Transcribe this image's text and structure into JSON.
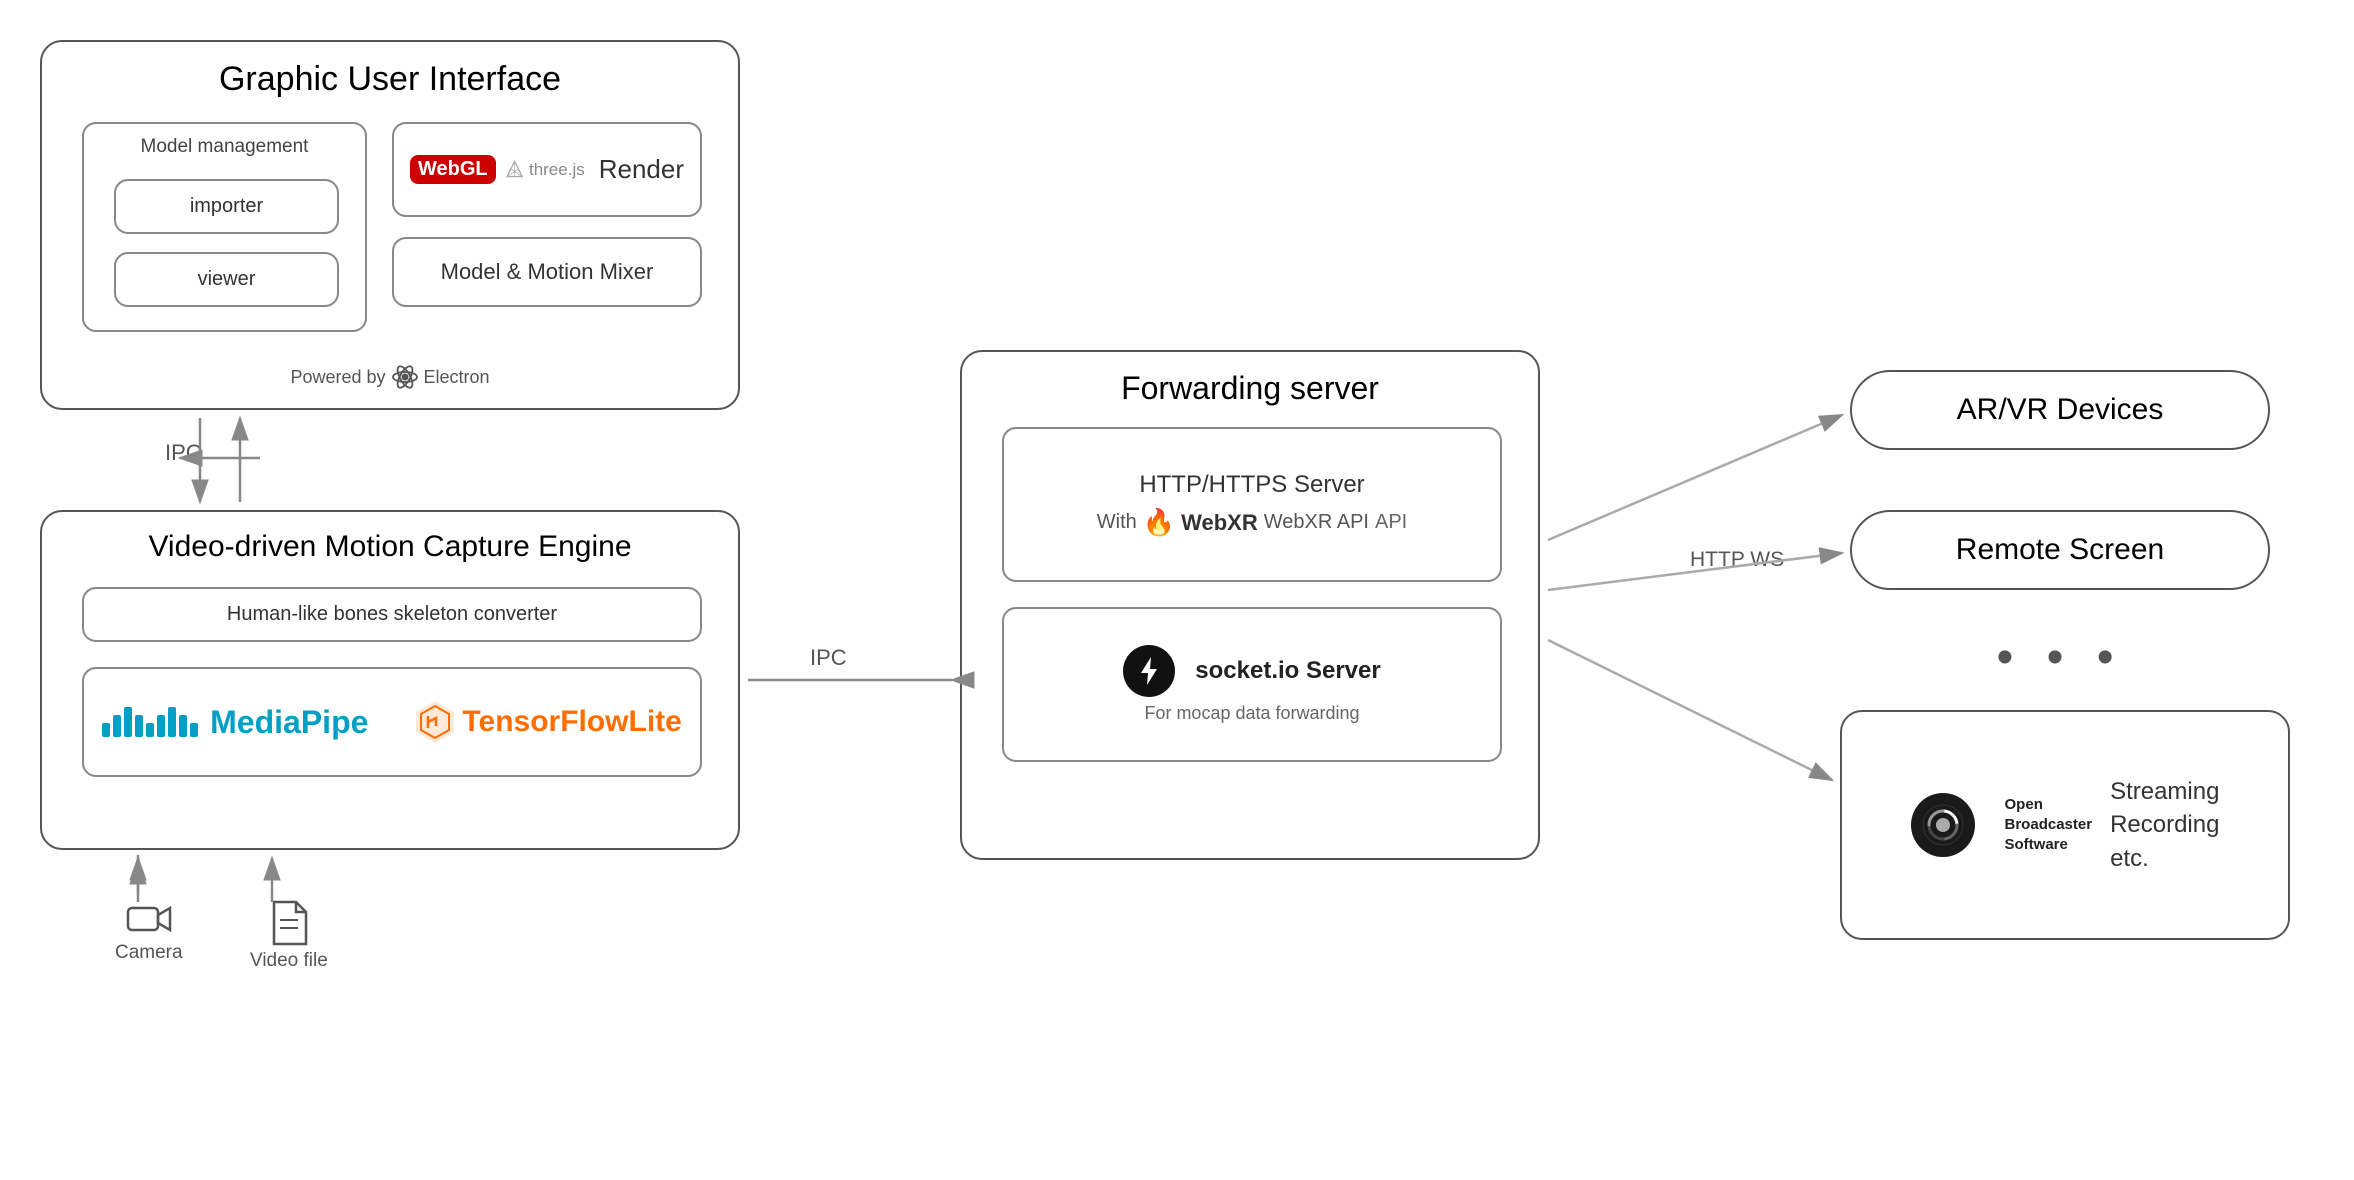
{
  "gui": {
    "title": "Graphic User Interface",
    "model_mgmt_label": "Model management",
    "importer_label": "importer",
    "viewer_label": "viewer",
    "webgl_label": "Render",
    "threejs_text": "three.js",
    "mixer_label": "Model & Motion Mixer",
    "powered_by": "Powered by",
    "electron_label": "Electron"
  },
  "mce": {
    "title": "Video-driven Motion Capture Engine",
    "skeleton_label": "Human-like bones skeleton converter",
    "mediapipe_label": "MediaPipe",
    "tensorflow_label": "TensorFlowLite"
  },
  "ipc_label_1": "IPC",
  "ipc_label_2": "IPC",
  "fwd": {
    "title": "Forwarding server",
    "http_title": "HTTP/HTTPS Server",
    "webxr_text": "With",
    "webxr_api": "WebXR API",
    "socketio_title": "socket.io Server",
    "socketio_sub": "For mocap data forwarding"
  },
  "arvr": {
    "label": "AR/VR Devices"
  },
  "remote": {
    "label": "Remote Screen"
  },
  "dots": "•  •  •",
  "obs": {
    "obs_name": "Open\nBroadcaster\nSoftware",
    "streaming": "Streaming\nRecording\netc."
  },
  "http_ws_label": "HTTP\nWS",
  "camera_label": "Camera",
  "video_label": "Video file"
}
